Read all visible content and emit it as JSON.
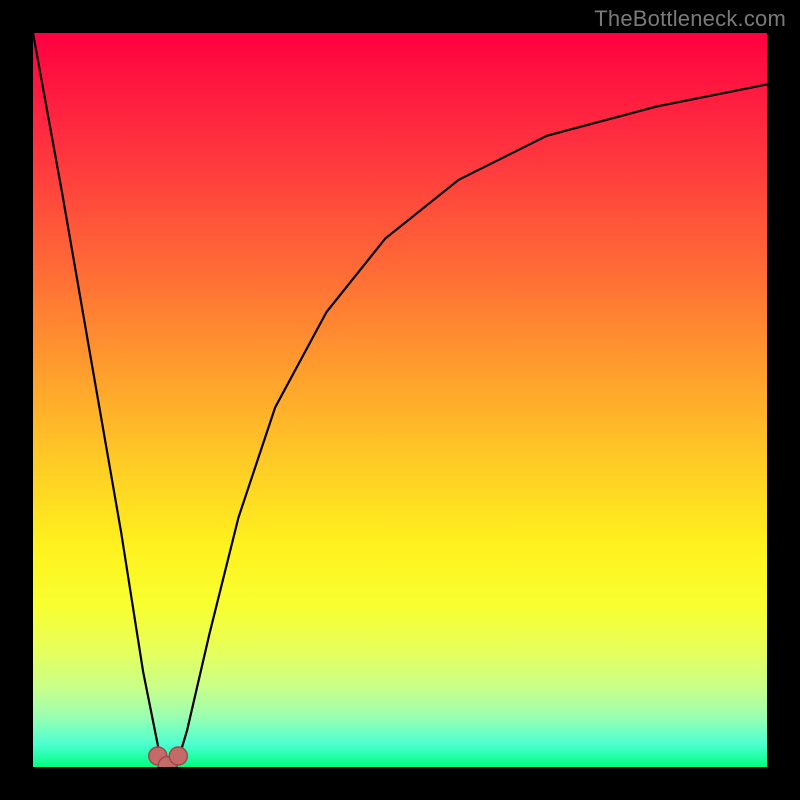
{
  "watermark": "TheBottleneck.com",
  "chart_data": {
    "type": "line",
    "title": "",
    "xlabel": "",
    "ylabel": "",
    "xlim": [
      0,
      100
    ],
    "ylim": [
      0,
      100
    ],
    "series": [
      {
        "name": "left-branch",
        "x": [
          0,
          4,
          8,
          12,
          15,
          17,
          17.5
        ],
        "y": [
          100,
          78,
          55,
          32,
          13,
          3,
          0
        ]
      },
      {
        "name": "right-branch",
        "x": [
          19.5,
          21,
          24,
          28,
          33,
          40,
          48,
          58,
          70,
          85,
          100
        ],
        "y": [
          0,
          5,
          18,
          34,
          49,
          62,
          72,
          80,
          86,
          90,
          93
        ]
      }
    ],
    "markers": [
      {
        "name": "vertex-left",
        "x": 17.0,
        "y": 1.5
      },
      {
        "name": "vertex-mid",
        "x": 18.3,
        "y": 0.2
      },
      {
        "name": "vertex-right",
        "x": 19.8,
        "y": 1.5
      }
    ],
    "background_gradient": {
      "top": "#ff0040",
      "middle": "#ffe020",
      "bottom": "#00ff80"
    }
  }
}
